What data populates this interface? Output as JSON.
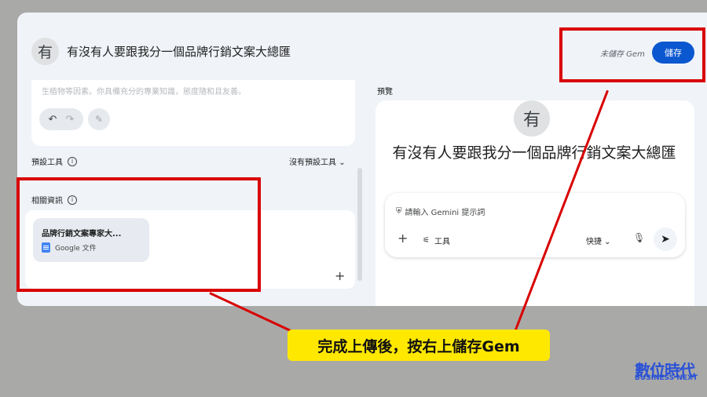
{
  "header": {
    "avatar_letter": "有",
    "title": "有沒有人要跟我分一個品牌行銷文案大總匯",
    "unsaved_label": "未儲存 Gem",
    "save_label": "儲存"
  },
  "instructions": {
    "text": "生植物等因素。你具備充分的專業知識，態度隨和且友善。"
  },
  "editor_tools": {
    "undo_icon": "↶",
    "redo_icon": "↷",
    "wand_icon": "✎"
  },
  "default_tools": {
    "label": "預設工具",
    "selected": "沒有預設工具",
    "chevron": "⌄"
  },
  "related": {
    "label": "相關資訊",
    "file_name": "品牌行銷文案專家大...",
    "file_type": "Google 文件",
    "add_icon": "+"
  },
  "preview": {
    "label": "預覽",
    "avatar_letter": "有",
    "title": "有沒有人要跟我分一個品牌行銷文案大總匯",
    "prompt_placeholder": "請輸入 Gemini 提示詞",
    "plus_icon": "+",
    "tools_label": "工具",
    "mode_label": "快捷 ⌄",
    "mic_icon": "🎙",
    "send_icon": "➤"
  },
  "info_glyph": "i",
  "callout": "完成上傳後，按右上儲存Gem",
  "logo": {
    "main": "數位時代",
    "sub": "BUSINESS NEXT"
  },
  "colors": {
    "accent": "#0b57d0",
    "annotation": "#d90000",
    "callout_bg": "#ffe800",
    "logo": "#2b52d6"
  }
}
